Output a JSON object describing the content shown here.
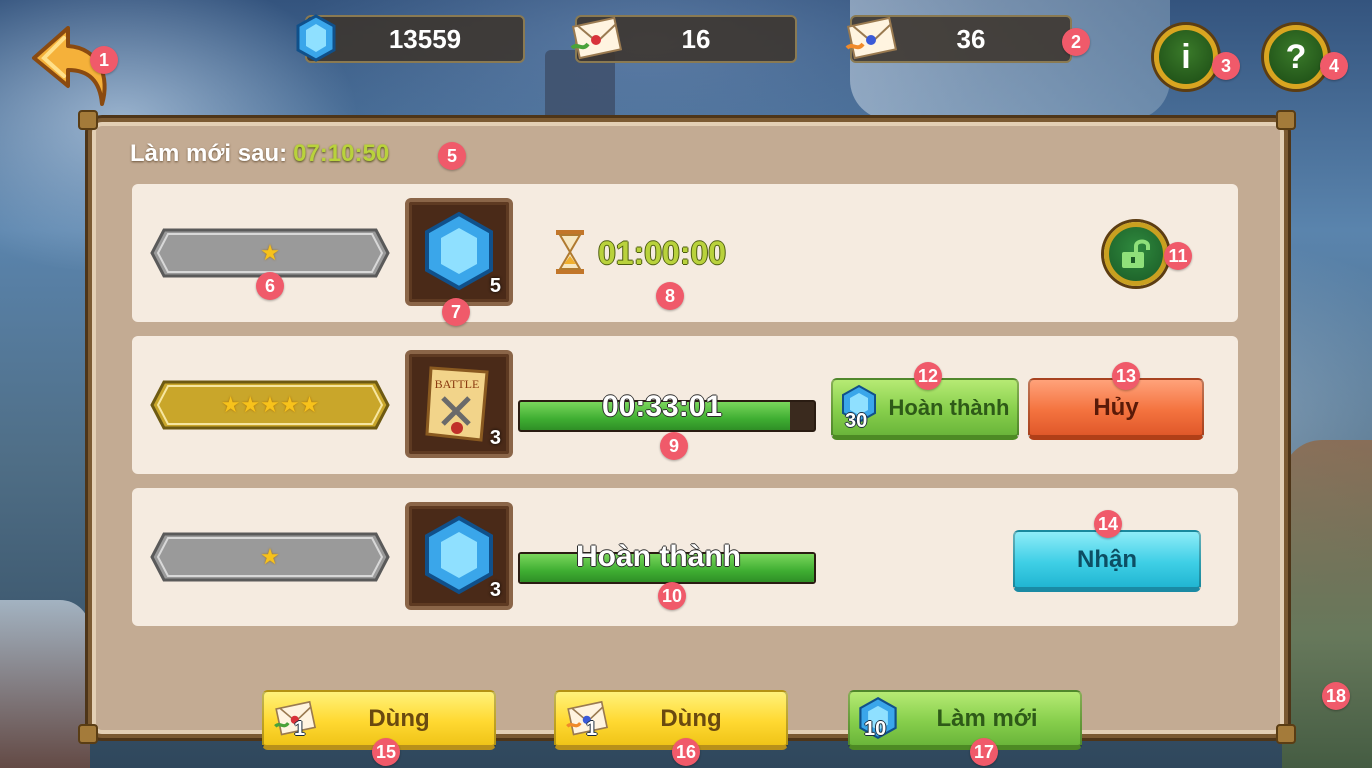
{
  "resources": {
    "gems": "13559",
    "letter_green": "16",
    "letter_orange": "36"
  },
  "header": {
    "info_label": "i",
    "help_label": "?"
  },
  "refresh": {
    "label": "Làm mới sau:",
    "time": "07:10:50"
  },
  "missions": [
    {
      "stars": "★",
      "item_icon": "gem-icon",
      "item_count": "5",
      "duration": "01:00:00",
      "state": "locked"
    },
    {
      "stars": "★★★★★",
      "item_icon": "battle-scroll-icon",
      "item_count": "3",
      "progress_time": "00:33:01",
      "progress": 0.92,
      "complete_cost": "30",
      "complete_label": "Hoàn thành",
      "cancel_label": "Hủy",
      "state": "in_progress"
    },
    {
      "stars": "★",
      "item_icon": "gem-icon",
      "item_count": "3",
      "progress_text": "Hoàn thành",
      "progress": 1.0,
      "claim_label": "Nhận",
      "state": "done"
    }
  ],
  "footer": {
    "use_green_count": "1",
    "use_green_label": "Dùng",
    "use_orange_count": "1",
    "use_orange_label": "Dùng",
    "refresh_cost": "10",
    "refresh_label": "Làm mới"
  },
  "markers": [
    "1",
    "2",
    "3",
    "4",
    "5",
    "6",
    "7",
    "8",
    "9",
    "10",
    "11",
    "12",
    "13",
    "14",
    "15",
    "16",
    "17",
    "18"
  ],
  "colors": {
    "accent_green": "#b9d23c",
    "panel_bg": "#c3ab93",
    "row_bg": "#f5ebe0",
    "marker": "#f05a6a"
  }
}
